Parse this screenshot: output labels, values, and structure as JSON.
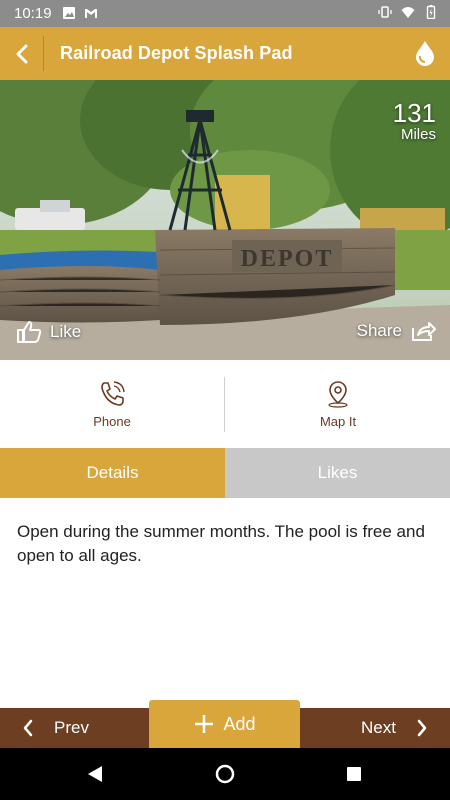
{
  "status_bar": {
    "time": "10:19",
    "icons_left": [
      "image-icon",
      "gmail-icon"
    ],
    "icons_right": [
      "vibrate-icon",
      "wifi-icon",
      "battery-icon"
    ]
  },
  "app_bar": {
    "title": "Railroad Depot Splash Pad",
    "back_icon": "chevron-left-icon",
    "action_icon": "water-drop-icon",
    "color": "#d9a63c"
  },
  "hero": {
    "sign_text": "DEPOT",
    "distance_value": "131",
    "distance_unit": "Miles",
    "like_label": "Like",
    "share_label": "Share"
  },
  "actions": {
    "phone_label": "Phone",
    "map_label": "Map It"
  },
  "tabs": {
    "details_label": "Details",
    "likes_label": "Likes",
    "active": "Details"
  },
  "details": {
    "text": "Open during the summer months. The pool is free and open to all ages."
  },
  "bottom_nav": {
    "prev_label": "Prev",
    "add_label": "Add",
    "next_label": "Next",
    "bar_color": "#6e3e22"
  }
}
